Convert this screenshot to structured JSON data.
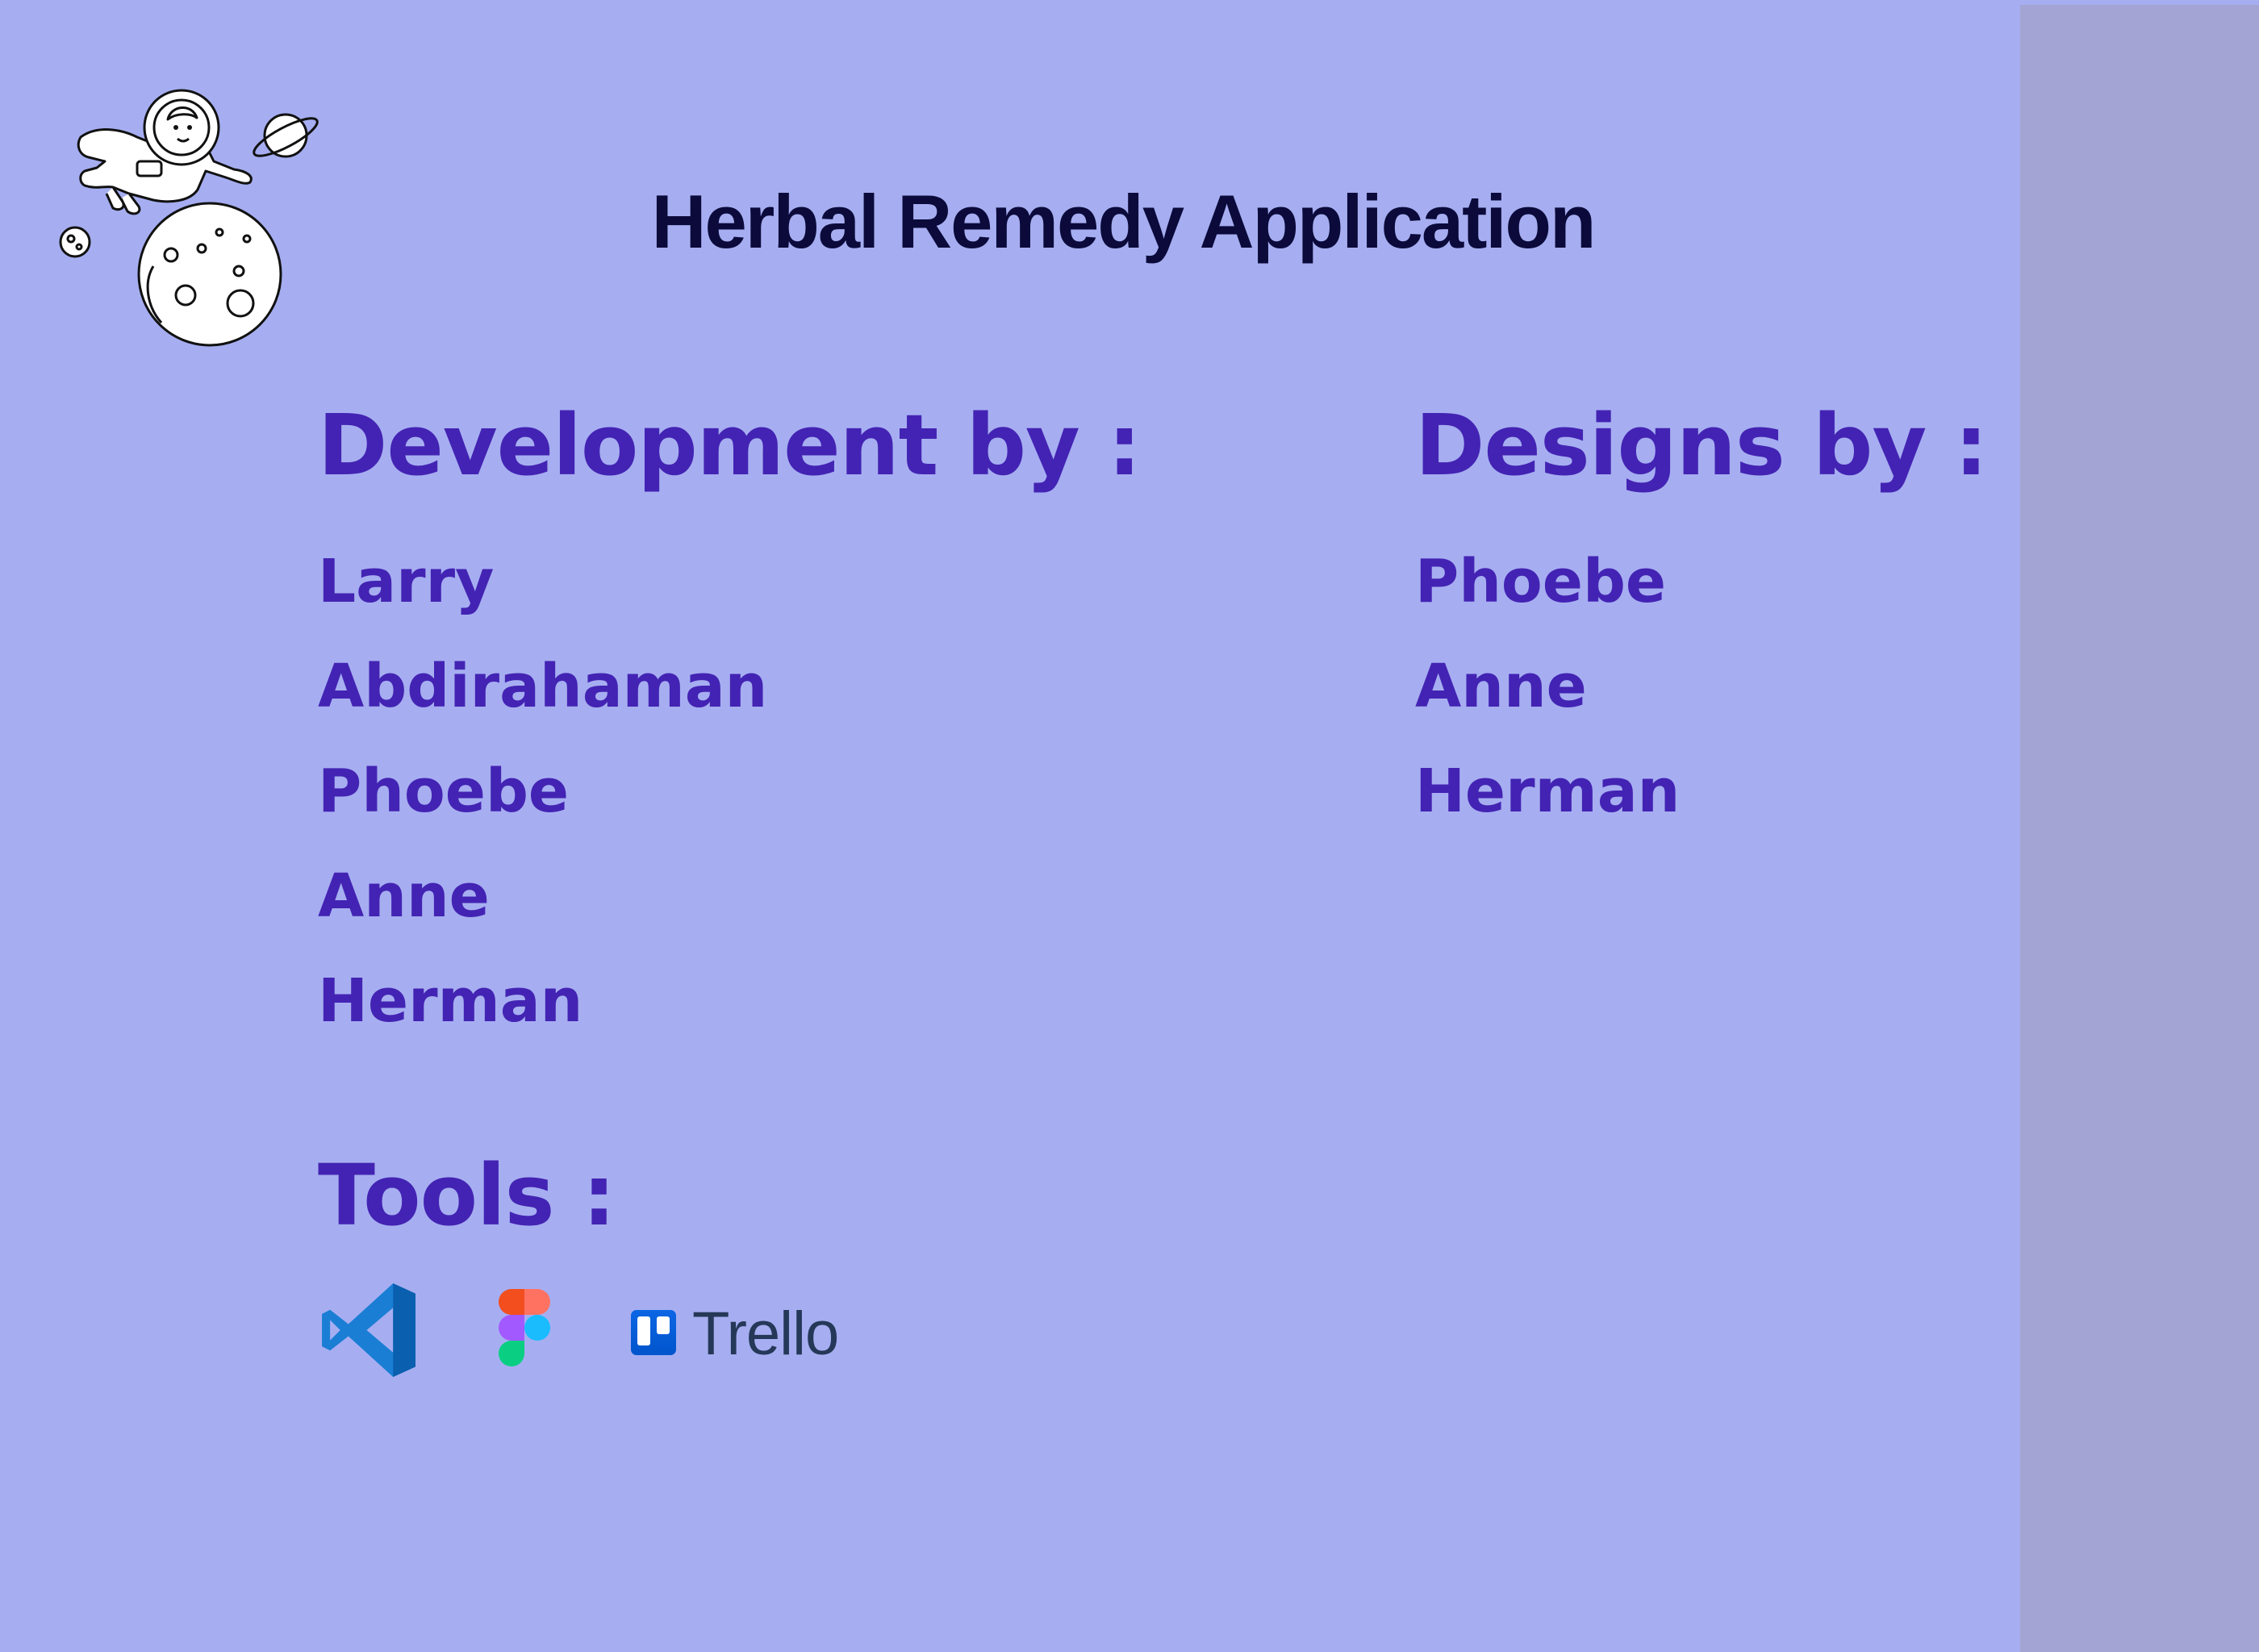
{
  "title": "Herbal Remedy Application",
  "development": {
    "heading": "Development by :",
    "names": [
      "Larry",
      "Abdirahaman",
      "Phoebe",
      "Anne",
      "Herman"
    ]
  },
  "designs": {
    "heading": "Designs by :",
    "names": [
      "Phoebe",
      "Anne",
      "Herman"
    ]
  },
  "tools": {
    "heading": "Tools :",
    "icons": [
      "vscode-icon",
      "figma-icon",
      "trello-icon"
    ],
    "trello_label": "Trello"
  },
  "colors": {
    "background": "#a6aef1",
    "side_panel": "#a3a4d3",
    "title": "#0b0a3a",
    "accent": "#4323b3"
  }
}
